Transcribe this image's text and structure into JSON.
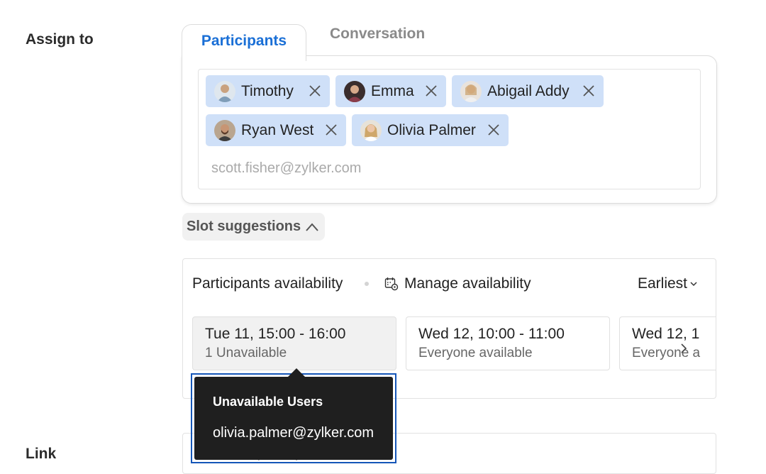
{
  "assign_label": "Assign to",
  "link_label": "Link",
  "tabs": [
    {
      "label": "Participants",
      "active": true
    },
    {
      "label": "Conversation",
      "active": false
    }
  ],
  "participants": [
    {
      "name": "Timothy"
    },
    {
      "name": "Emma"
    },
    {
      "name": "Abigail Addy"
    },
    {
      "name": "Ryan West"
    },
    {
      "name": "Olivia Palmer"
    }
  ],
  "participant_input": {
    "placeholder": "scott.fisher@zylker.com"
  },
  "slot_suggestions": {
    "label": "Slot suggestions"
  },
  "availability": {
    "title": "Participants availability",
    "manage_label": "Manage availability",
    "sort_label": "Earliest",
    "slots": [
      {
        "time": "Tue 11, 15:00 - 16:00",
        "status": "1 Unavailable"
      },
      {
        "time": "Wed 12, 10:00 - 11:00",
        "status": "Everyone available"
      },
      {
        "time": "Wed 12, 1",
        "status": "Everyone a"
      }
    ]
  },
  "tooltip": {
    "title": "Unavailable Users",
    "email": "olivia.palmer@zylker.com"
  },
  "link_input": {
    "placeholder": "with the participants."
  },
  "colors": {
    "accent": "#1a6fd6",
    "chip_bg": "#cfe0f8",
    "tooltip_bg": "#1f1f1f"
  }
}
